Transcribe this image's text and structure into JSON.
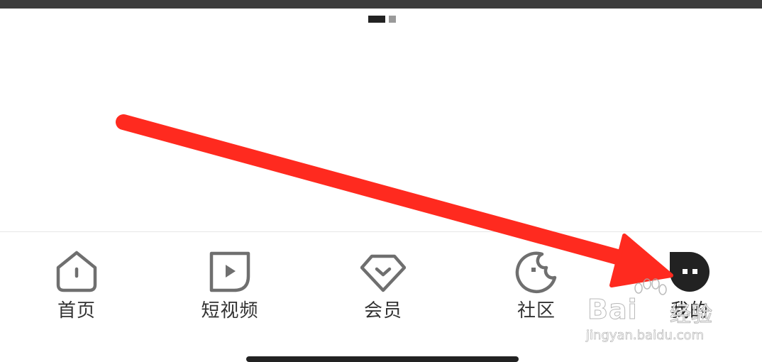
{
  "colors": {
    "arrow": "#ff2a1f",
    "icon_stroke": "#6f6f6f",
    "active_icon": "#222222",
    "label": "#333333"
  },
  "pager": {
    "current": 1,
    "total": 2
  },
  "tabs": [
    {
      "id": "home",
      "label": "首页",
      "icon": "house-icon",
      "active": false
    },
    {
      "id": "short-video",
      "label": "短视频",
      "icon": "play-square-icon",
      "active": false
    },
    {
      "id": "member",
      "label": "会员",
      "icon": "diamond-icon",
      "active": false
    },
    {
      "id": "community",
      "label": "社区",
      "icon": "planet-icon",
      "active": false
    },
    {
      "id": "mine",
      "label": "我的",
      "icon": "chat-bubble-icon",
      "active": true
    }
  ],
  "watermark": {
    "brand": "Bai",
    "suffix": "经验",
    "url": "jingyan.baidu.com"
  }
}
